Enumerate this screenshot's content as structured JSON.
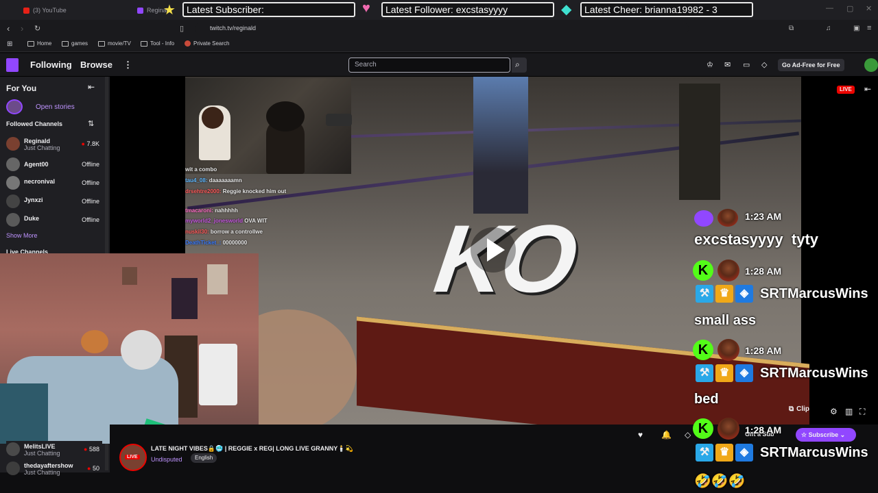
{
  "browser": {
    "tabs": [
      {
        "label": "(3) YouTube"
      },
      {
        "label": "Reginald"
      }
    ],
    "url": "twitch.tv/reginald",
    "bookmarks": [
      {
        "label": "Home"
      },
      {
        "label": "games"
      },
      {
        "label": "movie/TV"
      },
      {
        "label": "Tool - Info"
      },
      {
        "label": "Private Search"
      }
    ]
  },
  "overlay_alerts": {
    "subscriber": "Latest Subscriber:",
    "follower": "Latest Follower: excstasyyyy",
    "cheer": "Latest Cheer: brianna19982 - 3"
  },
  "twitch_nav": {
    "following": "Following",
    "browse": "Browse",
    "search_placeholder": "Search",
    "ad_free": "Go Ad-Free for Free"
  },
  "sidebar": {
    "for_you": "For You",
    "open_stories": "Open stories",
    "followed_channels": "Followed Channels",
    "channels": [
      {
        "name": "Reginald",
        "game": "Just Chatting",
        "status": "7.8K"
      },
      {
        "name": "Agent00",
        "game": "",
        "status": "Offline"
      },
      {
        "name": "necronival",
        "game": "",
        "status": "Offline"
      },
      {
        "name": "Jynxzi",
        "game": "",
        "status": "Offline"
      },
      {
        "name": "Duke",
        "game": "",
        "status": "Offline"
      }
    ],
    "show_more": "Show More",
    "live_channels": "Live Channels",
    "bottom_channels": [
      {
        "name": "MelitsLIVE",
        "game": "Just Chatting",
        "status": "588"
      },
      {
        "name": "thedayaftershow",
        "game": "Just Chatting",
        "status": "50"
      }
    ]
  },
  "player": {
    "live_badge": "LIVE",
    "ko_text": "KO",
    "clip": "Clip"
  },
  "stream_overlay_chat": [
    {
      "user": "",
      "text": "wit a combo"
    },
    {
      "user": "tau4_08:",
      "text": "daaaaaaamn"
    },
    {
      "user": "drsehtre2000:",
      "text": "Reggie knocked him out"
    },
    {
      "user": "tmacaroni:",
      "text": "nahhhhh"
    },
    {
      "user": "myworld2_jonesworld",
      "text": "OVA WIT"
    },
    {
      "user": "nuskil30:",
      "text": "borrow a controllwe"
    },
    {
      "user": "DeathTicket_:",
      "text": "00000000"
    }
  ],
  "right_chat": [
    {
      "time": "1:23 AM",
      "user": "excstasyyyy",
      "text": "tyty"
    },
    {
      "time": "1:28 AM",
      "user": "SRTMarcusWins",
      "text": "small ass"
    },
    {
      "time": "1:28 AM",
      "user": "SRTMarcusWins",
      "text": "bed"
    },
    {
      "time": "1:28 AM",
      "user": "SRTMarcusWins",
      "text": "🤣🤣🤣"
    }
  ],
  "stream_info": {
    "title": "LATE NIGHT VIBES🔒🥶 | REGGIE x REG| LONG LIVE GRANNY🕯️💫",
    "category": "Undisputed",
    "language": "English",
    "live": "LIVE",
    "subscribe": "Subscribe",
    "gift": "Gift a Sub"
  },
  "colors": {
    "twitch_purple": "#9147ff",
    "live_red": "#eb0400",
    "kick_green": "#53fc18"
  }
}
